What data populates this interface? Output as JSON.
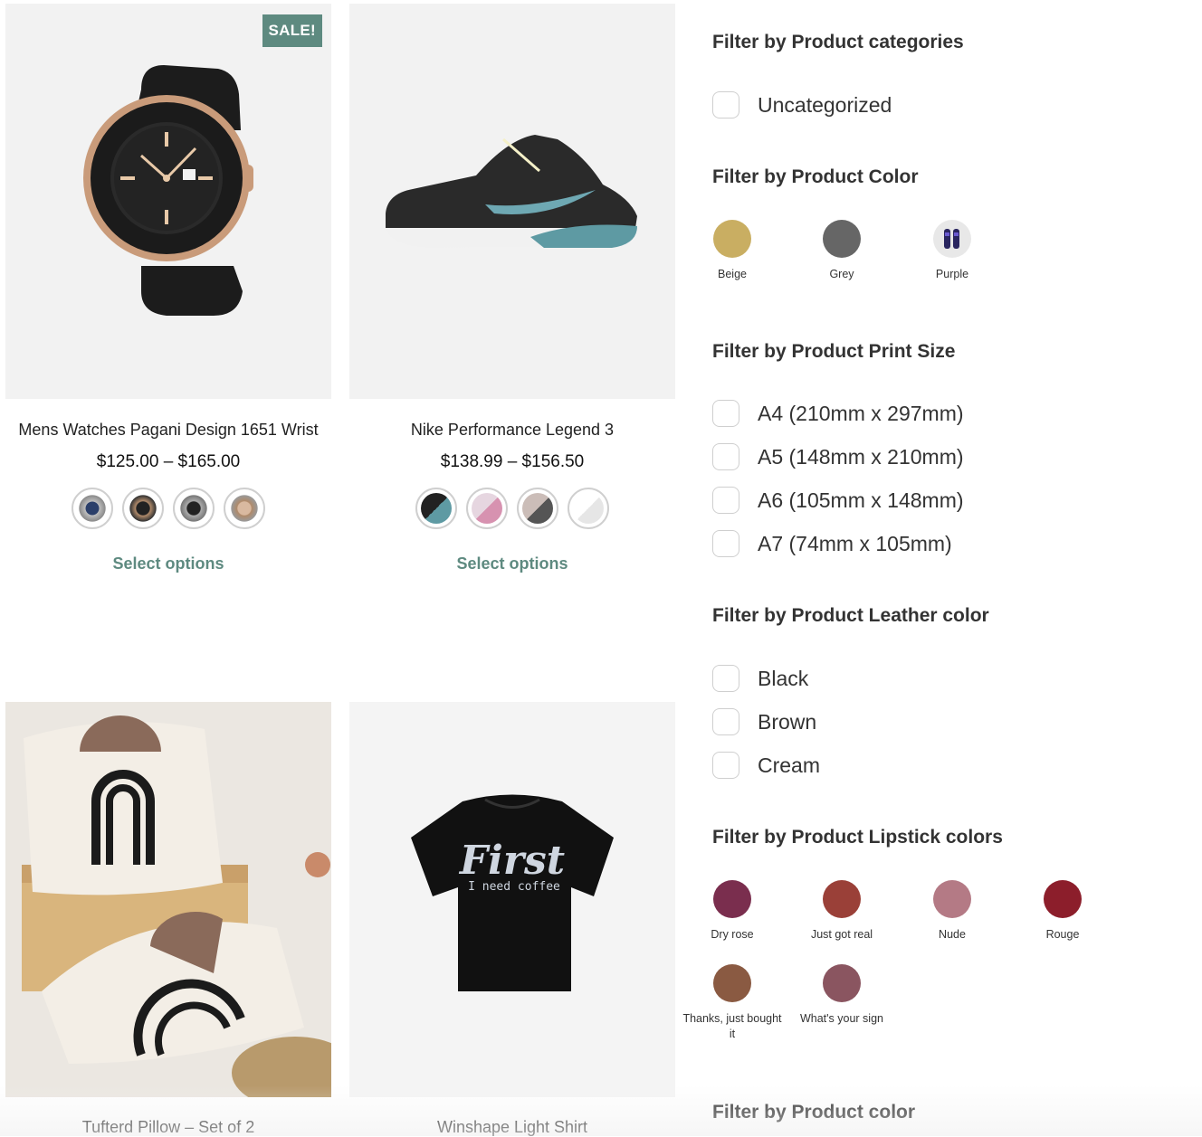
{
  "products": [
    {
      "title": "Mens Watches Pagani Design 1651 Wrist",
      "price": "$125.00 – $165.00",
      "sale_badge": "SALE!",
      "action": "Select options"
    },
    {
      "title": "Nike Performance Legend 3",
      "price": "$138.99 – $156.50",
      "action": "Select options"
    },
    {
      "title": "Tufterd Pillow – Set of 2"
    },
    {
      "title": "Winshape Light Shirt",
      "shirt_print_main": "First",
      "shirt_print_sub": "I need coffee"
    }
  ],
  "filters": {
    "categories": {
      "heading": "Filter by Product categories",
      "options": [
        "Uncategorized"
      ]
    },
    "color": {
      "heading": "Filter by Product Color",
      "options": [
        {
          "label": "Beige",
          "color": "#c9ae62"
        },
        {
          "label": "Grey",
          "color": "#666666"
        },
        {
          "label": "Purple",
          "color": "#e8e8e8"
        }
      ]
    },
    "print_size": {
      "heading": "Filter by Product Print Size",
      "options": [
        "A4 (210mm x 297mm)",
        "A5 (148mm x 210mm)",
        "A6 (105mm x 148mm)",
        "A7 (74mm x 105mm)"
      ]
    },
    "leather": {
      "heading": "Filter by Product Leather color",
      "options": [
        "Black",
        "Brown",
        "Cream"
      ]
    },
    "lipstick": {
      "heading": "Filter by Product Lipstick colors",
      "options": [
        {
          "label": "Dry rose",
          "color": "#7a2e4e"
        },
        {
          "label": "Just got real",
          "color": "#9a4038"
        },
        {
          "label": "Nude",
          "color": "#b47a85"
        },
        {
          "label": "Rouge",
          "color": "#8c1e2b"
        },
        {
          "label": "Thanks, just bought it",
          "color": "#8a5a42"
        },
        {
          "label": "What's your sign",
          "color": "#8a5560"
        }
      ]
    },
    "color2": {
      "heading": "Filter by Product color"
    }
  },
  "accent_color": "#5e8a80"
}
